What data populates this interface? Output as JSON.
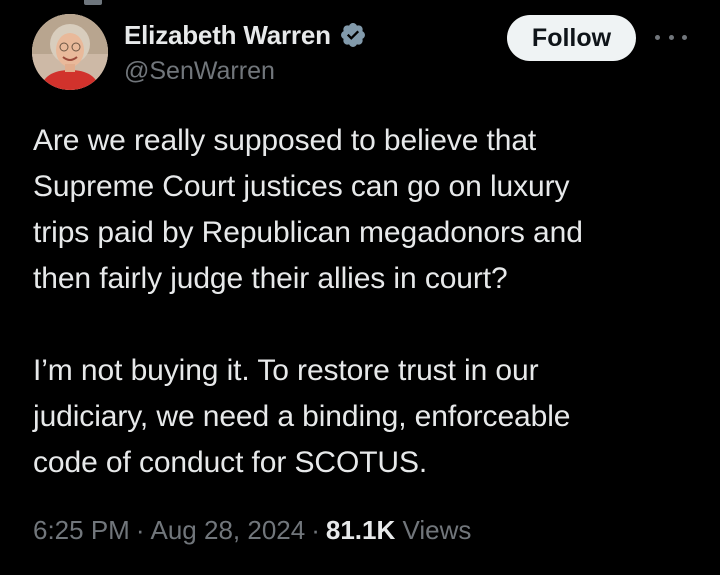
{
  "author": {
    "display_name": "Elizabeth Warren",
    "handle": "@SenWarren",
    "verified": true
  },
  "follow_label": "Follow",
  "more_icon": "more-horizontal-icon",
  "tweet": {
    "paragraph_1": "Are we really supposed to believe that\nSupreme Court justices can go on luxury\ntrips paid by Republican megadonors and\nthen fairly judge their allies in court?",
    "paragraph_2": "I’m not buying it. To restore trust in our\njudiciary, we need a binding, enforceable\ncode of conduct for SCOTUS."
  },
  "meta": {
    "time": "6:25 PM",
    "separator": "·",
    "date": "Aug 28, 2024",
    "views_count": "81.1K",
    "views_label": "Views"
  },
  "colors": {
    "background": "#000000",
    "text_primary": "#e7e9ea",
    "text_secondary": "#71767b",
    "verified_badge": "#829aab",
    "follow_bg": "#eff3f4"
  }
}
